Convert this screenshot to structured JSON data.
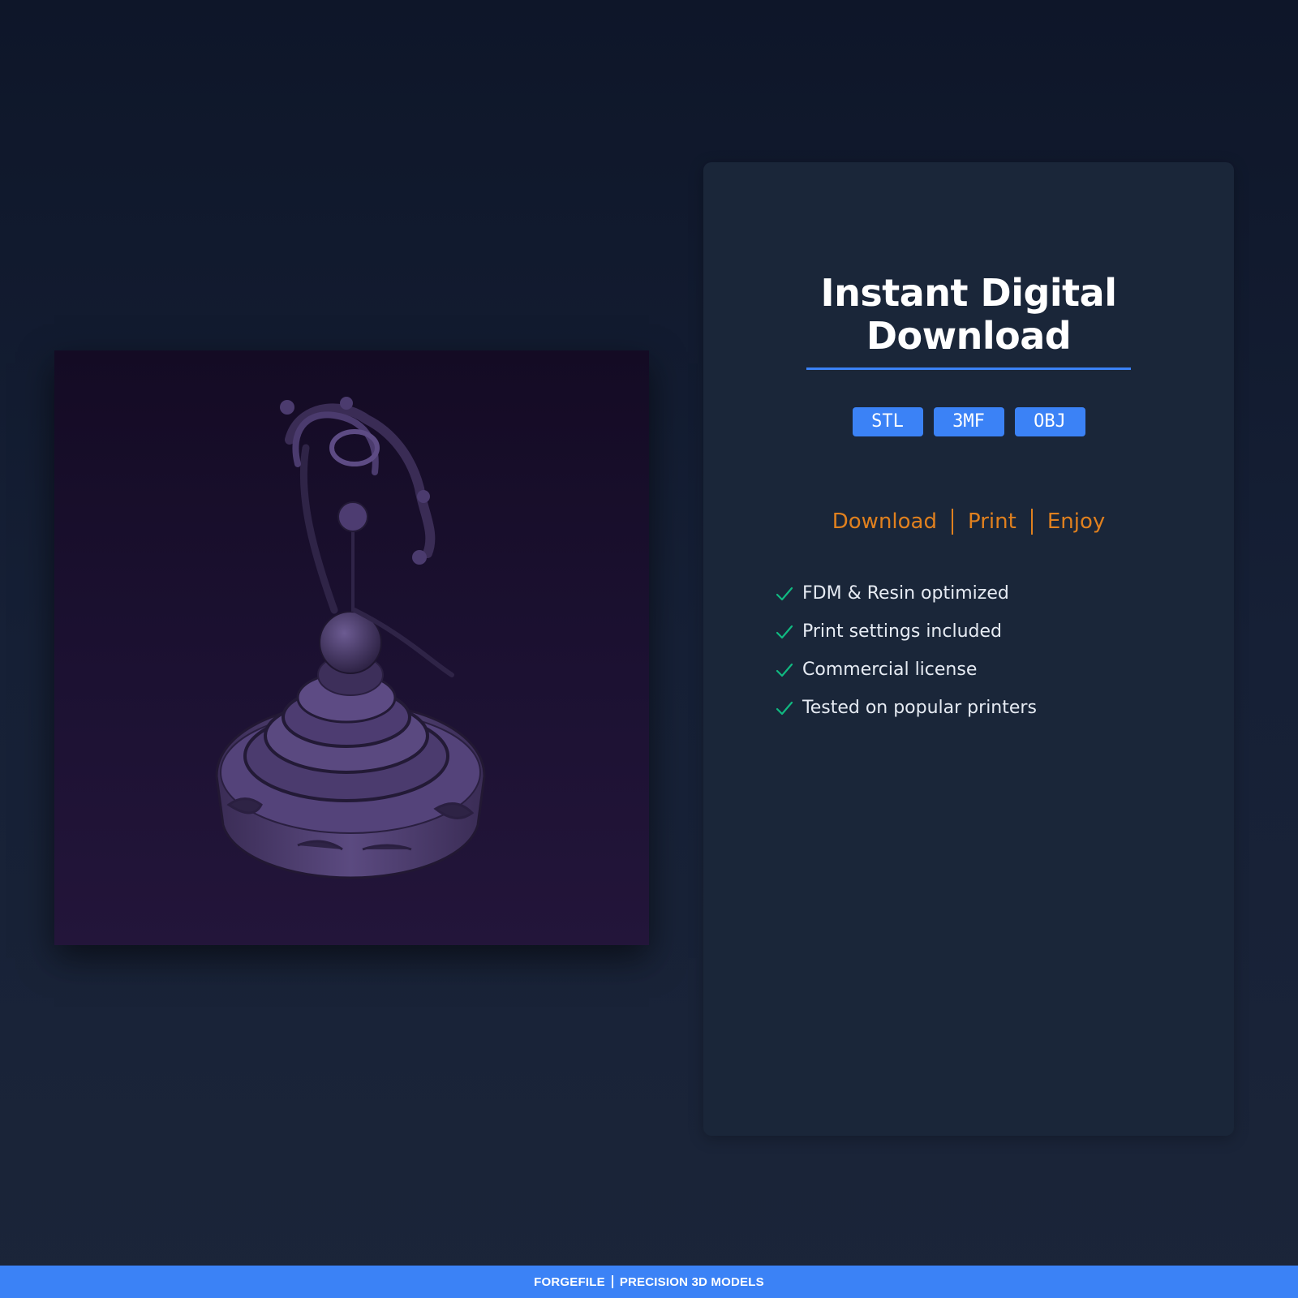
{
  "product": {
    "image_alt": "Ornate bell on tiered round pedestal, 3D model render"
  },
  "card": {
    "title_line1": "Instant Digital",
    "title_line2": "Download",
    "formats": [
      "STL",
      "3MF",
      "OBJ"
    ],
    "tagline": [
      "Download",
      "Print",
      "Enjoy"
    ],
    "features": [
      "FDM & Resin optimized",
      "Print settings included",
      "Commercial license",
      "Tested on popular printers"
    ]
  },
  "footer": {
    "brand": "FORGEFILE",
    "subtitle": "PRECISION 3D MODELS"
  },
  "colors": {
    "accent_blue": "#3b82f6",
    "accent_orange": "#e0801e",
    "check_green": "#10b981",
    "card_bg": "#1a2639"
  },
  "icons": {
    "feature_bullet": "check-icon"
  }
}
